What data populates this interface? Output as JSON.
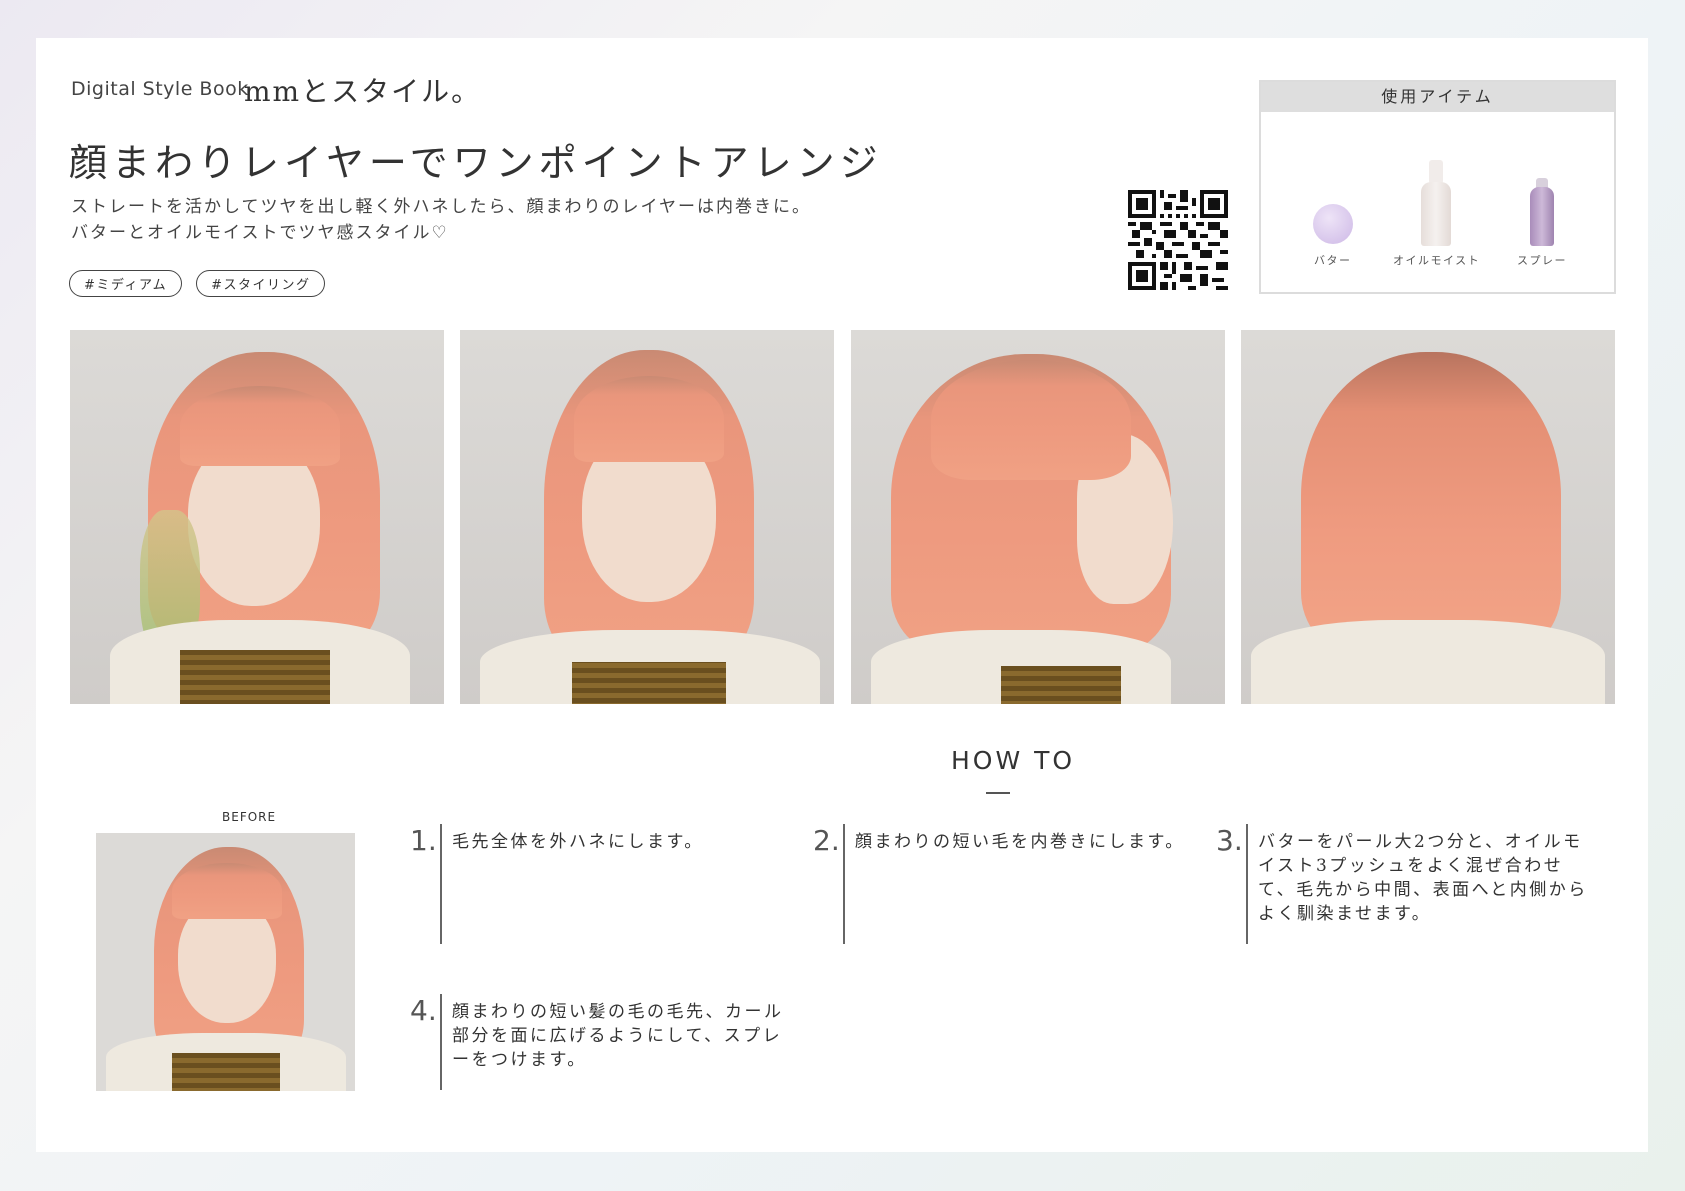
{
  "header": {
    "brand": "Digital Style Book",
    "brand_title": "mmとスタイル。",
    "title": "顔まわりレイヤーでワンポイントアレンジ",
    "description_lines": [
      "ストレートを活かしてツヤを出し軽く外ハネしたら、顔まわりのレイヤーは内巻きに。",
      "バターとオイルモイストでツヤ感スタイル♡"
    ],
    "tags": [
      "#ミディアム",
      "#スタイリング"
    ]
  },
  "items": {
    "heading": "使用アイテム",
    "products": [
      {
        "label": "バター",
        "color": "#d9c9ec"
      },
      {
        "label": "オイルモイスト",
        "color": "#ece6e4"
      },
      {
        "label": "スプレー",
        "color": "#b9a1c6"
      }
    ]
  },
  "howto": {
    "heading": "HOW TO",
    "before_label": "BEFORE",
    "steps": [
      {
        "num": "1.",
        "text": "毛先全体を外ハネにします。"
      },
      {
        "num": "2.",
        "text": "顔まわりの短い毛を内巻きにします。"
      },
      {
        "num": "3.",
        "text": "バターをパール大2つ分と、オイルモイスト3プッシュをよく混ぜ合わせて、毛先から中間、表面へと内側からよく馴染ませます。"
      },
      {
        "num": "4.",
        "text": "顔まわりの短い髪の毛の毛先、カール部分を面に広げるようにして、スプレーをつけます。"
      }
    ]
  },
  "colors": {
    "hair": "#ee9a7f",
    "text": "#333333",
    "tag_border": "#444444"
  }
}
